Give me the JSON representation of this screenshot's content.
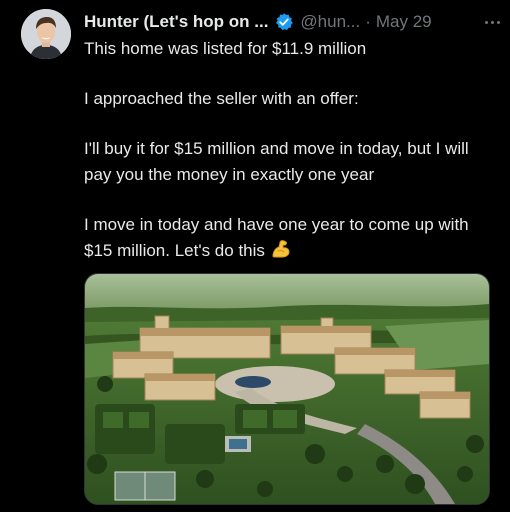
{
  "post": {
    "author_name": "Hunter (Let's hop on ...",
    "author_handle": "@hun...",
    "separator": "·",
    "date": "May 29",
    "text_lines": [
      "This home was listed for $11.9 million",
      "I approached the seller with an offer:",
      "I'll buy it for $15 million and move in today, but I will pay you the money in exactly one year",
      "I move in today and have one year to come up with $15 million. Let's do this"
    ],
    "emoji": "flexed-biceps-emoji"
  },
  "icons": {
    "verified": "verified-badge-icon",
    "more": "more-options-icon"
  },
  "media": {
    "image": "aerial-mansion-photo"
  },
  "colors": {
    "background": "#000000",
    "text_primary": "#e7e9ea",
    "text_secondary": "#71767b",
    "verified_blue": "#1d9bf0"
  }
}
